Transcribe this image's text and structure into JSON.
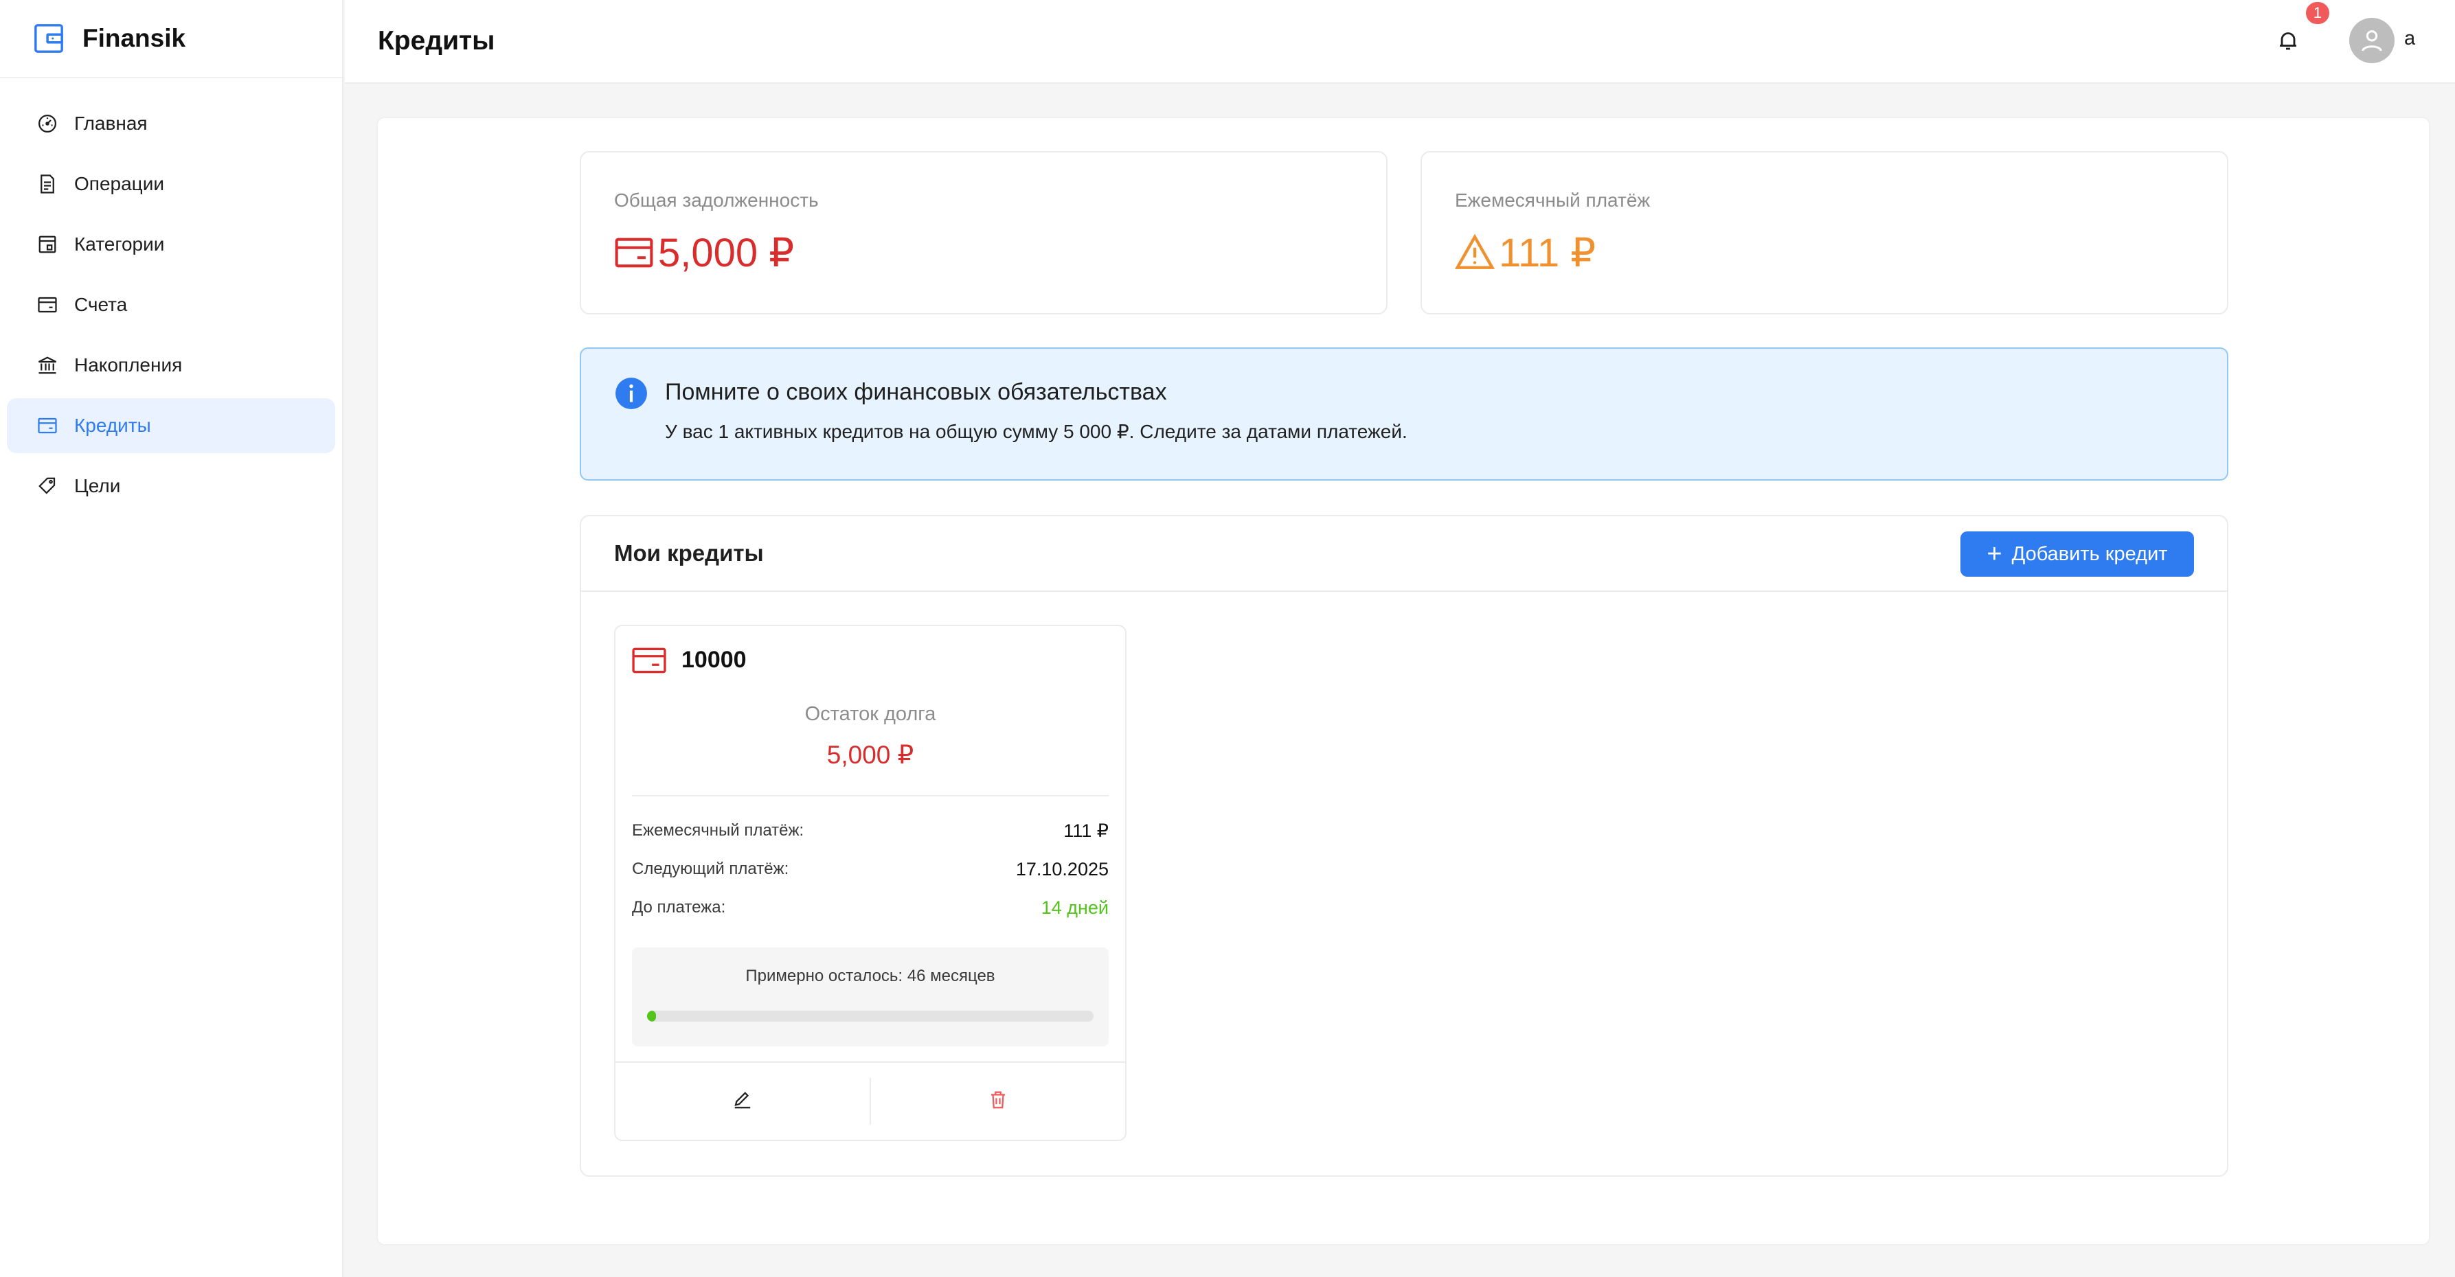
{
  "app": {
    "name": "Finansik"
  },
  "sidebar": {
    "items": [
      {
        "label": "Главная",
        "icon": "dashboard-icon",
        "active": false
      },
      {
        "label": "Операции",
        "icon": "file-icon",
        "active": false
      },
      {
        "label": "Категории",
        "icon": "category-icon",
        "active": false
      },
      {
        "label": "Счета",
        "icon": "card-icon",
        "active": false
      },
      {
        "label": "Накопления",
        "icon": "bank-icon",
        "active": false
      },
      {
        "label": "Кредиты",
        "icon": "credit-card-icon",
        "active": true
      },
      {
        "label": "Цели",
        "icon": "tag-icon",
        "active": false
      }
    ]
  },
  "header": {
    "title": "Кредиты",
    "notifications_count": "1",
    "username": "a"
  },
  "stats": {
    "total_debt": {
      "label": "Общая задолженность",
      "value": "5,000 ₽",
      "icon": "credit-card-icon",
      "color": "#d92d2d"
    },
    "monthly_payment": {
      "label": "Ежемесячный платёж",
      "value": "111 ₽",
      "icon": "warning-icon",
      "color": "#f0912f"
    }
  },
  "alert": {
    "title": "Помните о своих финансовых обязательствах",
    "text": "У вас 1 активных кредитов на общую сумму 5 000 ₽. Следите за датами платежей."
  },
  "credits": {
    "title": "Мои кредиты",
    "add_button": "Добавить кредит",
    "items": [
      {
        "name": "10000",
        "remaining_label": "Остаток долга",
        "remaining_value": "5,000 ₽",
        "rows": [
          {
            "label": "Ежемесячный платёж:",
            "value": "111 ₽"
          },
          {
            "label": "Следующий платёж:",
            "value": "17.10.2025"
          },
          {
            "label": "До платежа:",
            "value": "14 дней"
          }
        ],
        "progress_label": "Примерно осталось: 46 месяцев",
        "progress": 0.02
      }
    ]
  },
  "colors": {
    "accent": "#2f7cf0",
    "danger": "#d92d2d",
    "warning": "#f0912f",
    "success": "#52c41a"
  }
}
